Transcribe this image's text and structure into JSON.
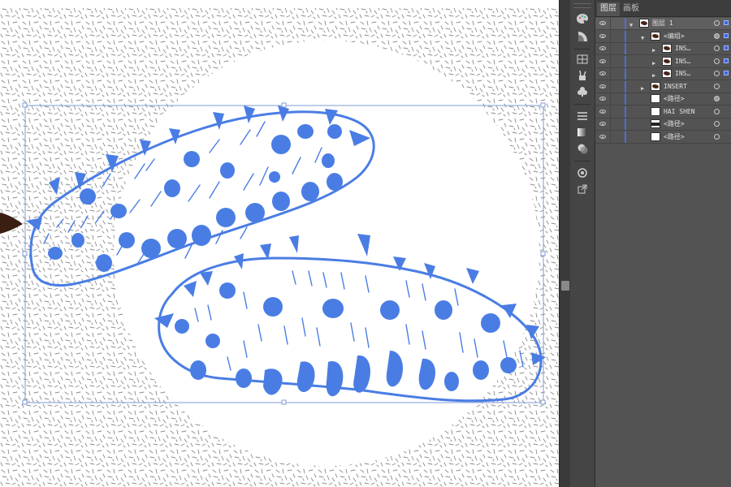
{
  "colors": {
    "artwork_blue": "#4a7de4",
    "layer_color": "#4a6fd8",
    "panel_bg": "#535353",
    "toolstrip_bg": "#454545",
    "bounding_box": "#7f9bd6",
    "texture": "#8c8c8c"
  },
  "panel": {
    "tabs": [
      {
        "label": "图层",
        "active": true
      },
      {
        "label": "画板",
        "active": false
      }
    ],
    "layers": [
      {
        "name": "图层 1",
        "twirl": "open",
        "thumb": "dark",
        "target": "outline",
        "selected": true
      },
      {
        "name": "<编组>",
        "twirl": "open",
        "thumb": "dark",
        "target": "filled",
        "selected": true
      },
      {
        "name": "INS…",
        "twirl": "closed",
        "thumb": "dark",
        "target": "outline",
        "selected": true
      },
      {
        "name": "INS…",
        "twirl": "closed",
        "thumb": "dark",
        "target": "outline",
        "selected": true
      },
      {
        "name": "INS…",
        "twirl": "closed",
        "thumb": "dark",
        "target": "outline",
        "selected": true
      },
      {
        "name": "INSERT",
        "twirl": "closed",
        "thumb": "dark",
        "target": "outline",
        "selected": false
      },
      {
        "name": "<路径>",
        "twirl": "none",
        "thumb": "white",
        "target": "filled",
        "selected": false
      },
      {
        "name": "HAI SHEN",
        "twirl": "none",
        "thumb": "white",
        "target": "outline",
        "selected": false
      },
      {
        "name": "<路径>",
        "twirl": "none",
        "thumb": "band",
        "target": "outline",
        "selected": false
      },
      {
        "name": "<路径>",
        "twirl": "none",
        "thumb": "white",
        "target": "outline",
        "selected": false
      }
    ]
  },
  "toolstrip": {
    "icons": [
      "palette-icon",
      "gradient-swatch-icon",
      "grid-icon",
      "brushes-icon",
      "symbols-icon",
      "lines-icon",
      "gradient-icon",
      "transparency-icon",
      "appearance-icon",
      "export-icon"
    ]
  }
}
